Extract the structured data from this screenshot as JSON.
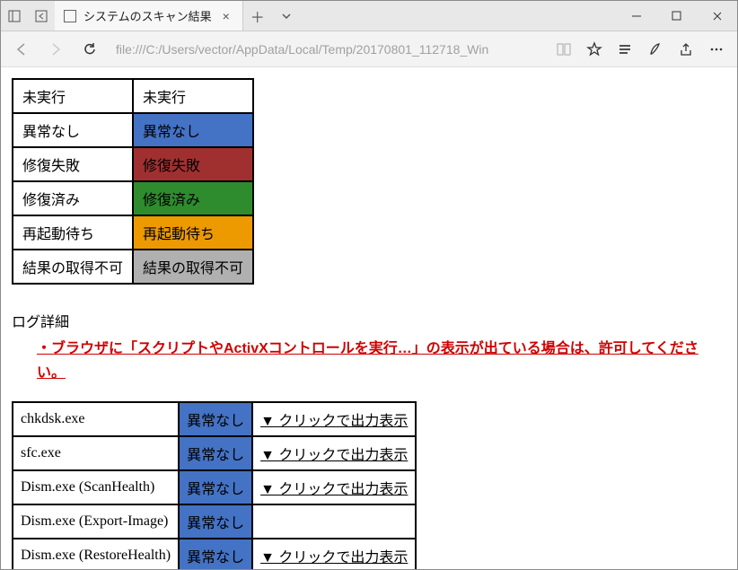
{
  "window": {
    "tab_title": "システムのスキャン結果",
    "url": "file:///C:/Users/vector/AppData/Local/Temp/20170801_112718_Win"
  },
  "legend": {
    "rows": [
      {
        "left": "未実行",
        "right": "未実行",
        "class": ""
      },
      {
        "left": "異常なし",
        "right": "異常なし",
        "class": "c-blue"
      },
      {
        "left": "修復失敗",
        "right": "修復失敗",
        "class": "c-red"
      },
      {
        "left": "修復済み",
        "right": "修復済み",
        "class": "c-green"
      },
      {
        "left": "再起動待ち",
        "right": "再起動待ち",
        "class": "c-orange"
      },
      {
        "left": "結果の取得不可",
        "right": "結果の取得不可",
        "class": "c-grey"
      }
    ]
  },
  "log": {
    "section_title": "ログ詳細",
    "warning": "・ブラウザに「スクリプトやActivXコントロールを実行…」の表示が出ている場合は、許可してください。",
    "click_label": "▼ クリックで出力表示",
    "rows": [
      {
        "name": "chkdsk.exe",
        "status": "異常なし",
        "has_action": true
      },
      {
        "name": "sfc.exe",
        "status": "異常なし",
        "has_action": true
      },
      {
        "name": "Dism.exe (ScanHealth)",
        "status": "異常なし",
        "has_action": true
      },
      {
        "name": "Dism.exe (Export-Image)",
        "status": "異常なし",
        "has_action": false
      },
      {
        "name": "Dism.exe (RestoreHealth)",
        "status": "異常なし",
        "has_action": true
      }
    ]
  }
}
